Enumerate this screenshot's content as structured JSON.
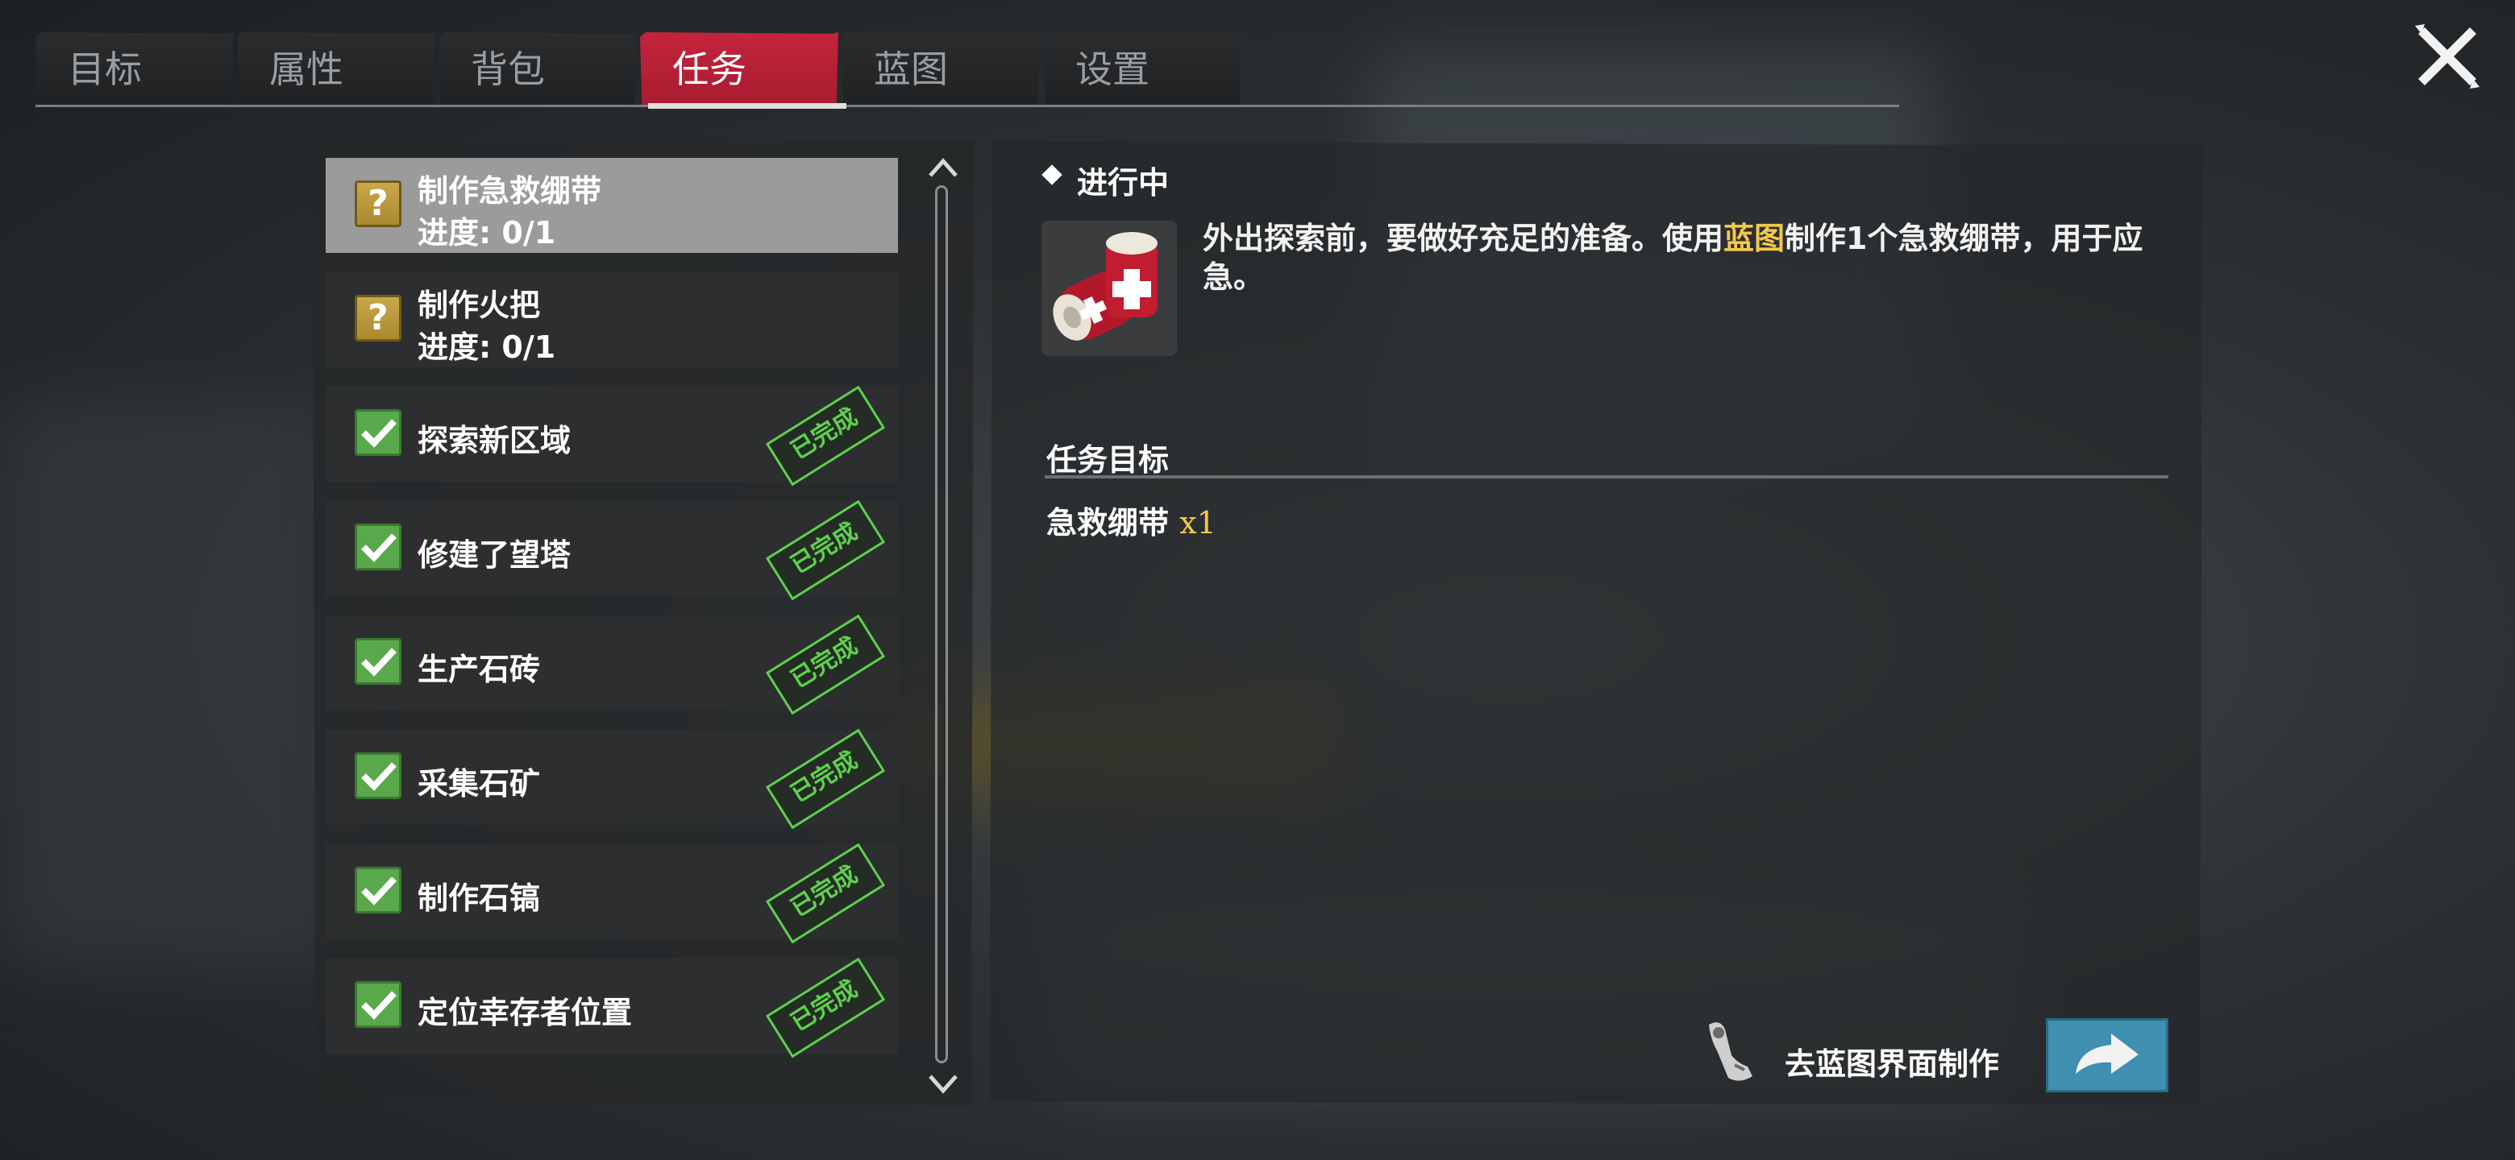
{
  "tabs": [
    {
      "label": "目标"
    },
    {
      "label": "属性"
    },
    {
      "label": "背包"
    },
    {
      "label": "任务"
    },
    {
      "label": "蓝图"
    },
    {
      "label": "设置"
    }
  ],
  "active_tab": "任务",
  "quest_list": [
    {
      "title": "制作急救绷带",
      "progress": "进度: 0/1",
      "status": "in-progress",
      "icon": "question-icon"
    },
    {
      "title": "制作火把",
      "progress": "进度: 0/1",
      "status": "in-progress",
      "icon": "question-icon"
    },
    {
      "title": "探索新区域",
      "stamp": "已完成",
      "status": "done",
      "icon": "checkmark-icon"
    },
    {
      "title": "修建了望塔",
      "stamp": "已完成",
      "status": "done",
      "icon": "checkmark-icon"
    },
    {
      "title": "生产石砖",
      "stamp": "已完成",
      "status": "done",
      "icon": "checkmark-icon"
    },
    {
      "title": "采集石矿",
      "stamp": "已完成",
      "status": "done",
      "icon": "checkmark-icon"
    },
    {
      "title": "制作石镐",
      "stamp": "已完成",
      "status": "done",
      "icon": "checkmark-icon"
    },
    {
      "title": "定位幸存者位置",
      "stamp": "已完成",
      "status": "done",
      "icon": "checkmark-icon"
    }
  ],
  "detail": {
    "status": "进行中",
    "desc_part1": "外出探索前，要做好充足的准备。使用",
    "desc_highlight": "蓝图",
    "desc_part2": "制作1个急救绷带，用于应急。",
    "objective_title": "任务目标",
    "objective_item": "急救绷带",
    "objective_count": "x1",
    "goto_label": "去蓝图界面制作"
  },
  "colors": {
    "active_tab": "#c4243b",
    "highlight": "#f3c94b",
    "done_green": "#5fd04e",
    "goto_button": "#3e8fb0"
  }
}
